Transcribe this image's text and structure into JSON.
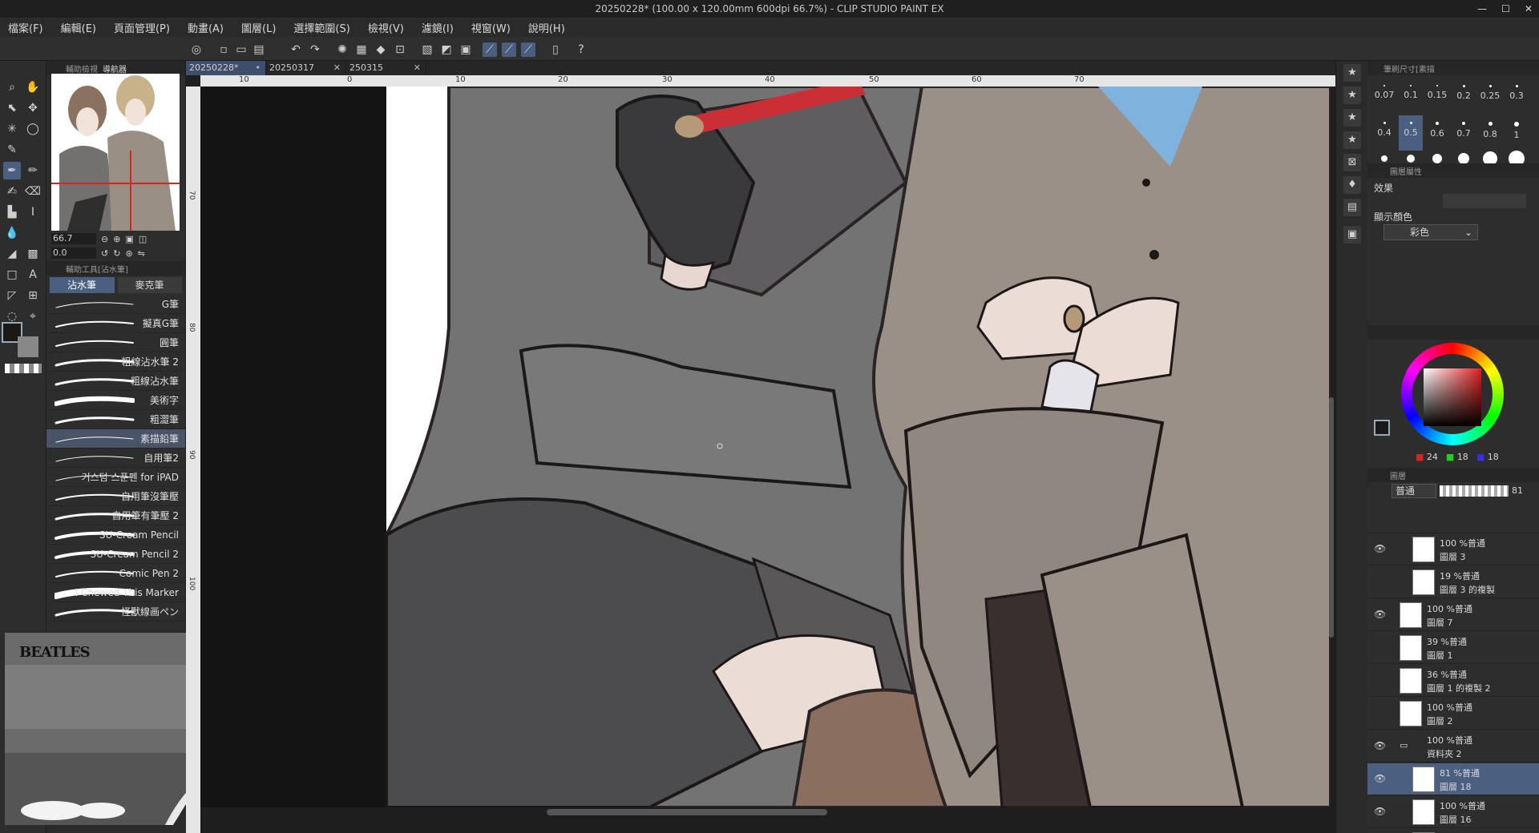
{
  "window": {
    "title": "20250228* (100.00 x 120.00mm 600dpi 66.7%) - CLIP STUDIO PAINT EX"
  },
  "menu": [
    "檔案(F)",
    "編輯(E)",
    "頁面管理(P)",
    "動畫(A)",
    "圖層(L)",
    "選擇範圍(S)",
    "檢視(V)",
    "濾鏡(I)",
    "視窗(W)",
    "說明(H)"
  ],
  "navigator": {
    "tabs": [
      "輔助檢視",
      "導航器"
    ],
    "zoom": "66.7",
    "rotation": "0.0"
  },
  "subtool_panel": {
    "header": "輔助工具[沾水筆]",
    "groups": [
      "沾水筆",
      "麥克筆"
    ],
    "brushes": [
      "G筆",
      "擬真G筆",
      "圓筆",
      "粗線沾水筆 2",
      "粗線沾水筆",
      "美術字",
      "粗澀筆",
      "素描鉛筆",
      "自用筆2",
      "커스텀 스푼펜 for iPAD",
      "自用筆沒筆壓",
      "自用筆有筆壓 2",
      "SU-Cream Pencil",
      "SU-Cream Pencil 2",
      "Comic Pen 2",
      "I Chewed This Marker",
      "怪獸線画ペン"
    ],
    "selected_index": 7
  },
  "webcam": {
    "logo": "BEATLES"
  },
  "document_tabs": [
    {
      "label": "20250228*",
      "active": true
    },
    {
      "label": "20250317",
      "active": false
    },
    {
      "label": "250315",
      "active": false
    }
  ],
  "ruler": {
    "h_ticks": [
      "0",
      "10",
      "20",
      "30",
      "40",
      "50",
      "60",
      "70"
    ],
    "v_ticks": [
      "70",
      "80",
      "90",
      "100"
    ],
    "h_extra": "10"
  },
  "brush_size": {
    "header": "筆刷尺寸[素描",
    "sizes": [
      "0.07",
      "0.1",
      "0.15",
      "0.2",
      "0.25",
      "0.3",
      "0.4",
      "0.5",
      "0.6",
      "0.7",
      "0.8",
      "1"
    ],
    "selected": "0.5"
  },
  "layer_property": {
    "header": "圖層屬性",
    "effect_label": "效果",
    "display_color_label": "顯示顏色",
    "display_color_value": "彩色"
  },
  "color": {
    "r": "24",
    "g": "18",
    "b": "18",
    "main": "#1c1818"
  },
  "layers_panel": {
    "tab": "圖層",
    "blend_mode": "普通",
    "opacity": "81",
    "layers": [
      {
        "pct": "100 %普通",
        "name": "圖層 3",
        "visible": true,
        "indent": 1
      },
      {
        "pct": "19 %普通",
        "name": "圖層 3 的複製",
        "visible": false,
        "indent": 1
      },
      {
        "pct": "100 %普通",
        "name": "圖層 7",
        "visible": true,
        "indent": 0
      },
      {
        "pct": "39 %普通",
        "name": "圖層 1",
        "visible": false,
        "indent": 0
      },
      {
        "pct": "36 %普通",
        "name": "圖層 1 的複製 2",
        "visible": false,
        "indent": 0
      },
      {
        "pct": "100 %普通",
        "name": "圖層 2",
        "visible": false,
        "indent": 0
      },
      {
        "pct": "100 %普通",
        "name": "資料夾 2",
        "visible": true,
        "indent": 0,
        "folder": true
      },
      {
        "pct": "81 %普通",
        "name": "圖層 18",
        "visible": true,
        "indent": 1,
        "selected": true
      },
      {
        "pct": "100 %普通",
        "name": "圖層 16",
        "visible": true,
        "indent": 1
      },
      {
        "pct": "100 %普通",
        "name": "",
        "visible": false,
        "indent": 1
      }
    ]
  }
}
